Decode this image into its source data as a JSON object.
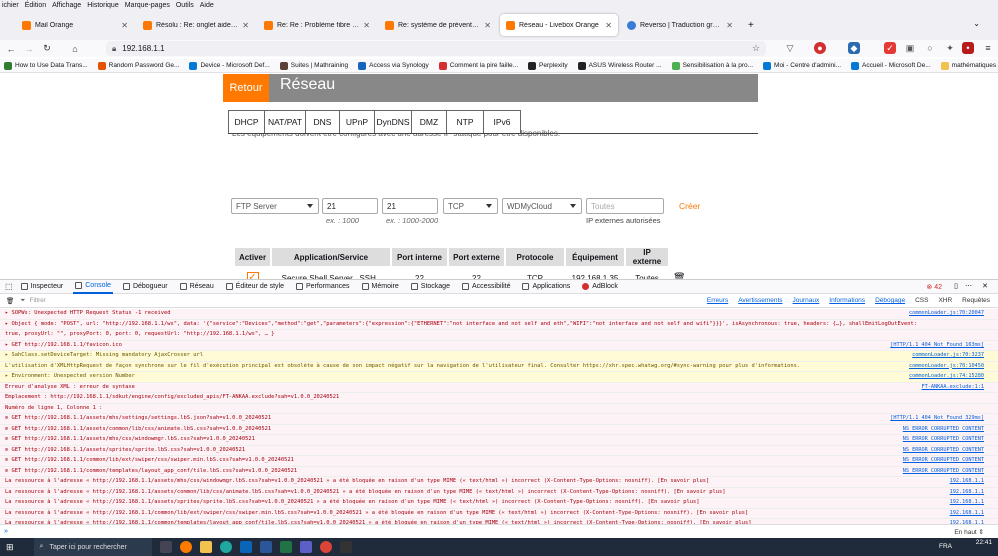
{
  "menubar": [
    "ichier",
    "Édition",
    "Affichage",
    "Historique",
    "Marque-pages",
    "Outils",
    "Aide"
  ],
  "tabs": [
    {
      "title": "Mail Orange",
      "fav": "orange",
      "active": false
    },
    {
      "title": "Résolu : Re: onglet aide et cont",
      "fav": "orange",
      "active": false
    },
    {
      "title": "Re: Re : Problème fibre récurren",
      "fav": "orange",
      "active": false
    },
    {
      "title": "Re: système de prévention d'int",
      "fav": "orange",
      "active": false
    },
    {
      "title": "Réseau - Livebox Orange",
      "fav": "orange",
      "active": true
    },
    {
      "title": "Reverso | Traduction gratuite, di",
      "fav": "blue",
      "active": false
    }
  ],
  "nav": {
    "url": "192.168.1.1",
    "back_icon": "arrow-left-icon",
    "forward_icon": "arrow-right-icon",
    "reload_icon": "reload-icon",
    "lock_icon": "lock-icon",
    "star_icon": "star-icon"
  },
  "bookmarks": [
    "How to Use Data Trans...",
    "Random Password Ge...",
    "Device - Microsoft Def...",
    "Suites | Mathraining",
    "Access via Synology",
    "Comment la pire faille...",
    "Perplexity",
    "ASUS Wireless Router ...",
    "Sensibilisation à la pro...",
    "Moi - Centre d'admini...",
    "Accueil - Microsoft De...",
    "mathématiques"
  ],
  "page": {
    "retour": "Retour",
    "title": "Réseau",
    "subtabs": [
      "DHCP",
      "NAT/PAT",
      "DNS",
      "UPnP",
      "DynDNS",
      "DMZ",
      "NTP",
      "IPv6"
    ],
    "cut_text": "Les équipements doivent être configurés avec une adresse IP statique pour être disponibles.",
    "form": {
      "application": "FTP Server",
      "port_int": "21",
      "port_int_hint": "ex. : 1000",
      "port_ext": "21",
      "port_ext_hint": "ex. : 1000-2000",
      "protocol": "TCP",
      "device": "WDMyCloud",
      "ip_placeholder": "Toutes",
      "ip_hint": "IP externes autorisées",
      "create": "Créer"
    },
    "table": {
      "headers": [
        "Activer",
        "Application/Service",
        "Port interne",
        "Port externe",
        "Protocole",
        "Équipement",
        "IP externe"
      ],
      "rows": [
        {
          "active": "✓",
          "app": "Secure Shell Server _SSH_",
          "port_int": "22",
          "port_ext": "22",
          "proto": "TCP",
          "device": "192.168.1.35",
          "ip": "Toutes"
        }
      ]
    }
  },
  "devtools": {
    "tabs": [
      "Inspecteur",
      "Console",
      "Débogueur",
      "Réseau",
      "Éditeur de style",
      "Performances",
      "Mémoire",
      "Stockage",
      "Accessibilité",
      "Applications",
      "AdBlock"
    ],
    "error_count": "42",
    "filter_placeholder": "Filtrer",
    "filters": [
      "Erreurs",
      "Avertissements",
      "Journaux",
      "Informations",
      "Débogage"
    ],
    "right_filters": [
      "CSS",
      "XHR",
      "Requêtes"
    ],
    "console_input": "»",
    "in_haut": "En haut ⇕"
  },
  "console_rows": [
    {
      "type": "err",
      "text": "▸ SOPWs: Unexpected HTTP Request Status -1 received",
      "src": "commonLoader.js:70:20047"
    },
    {
      "type": "err",
      "text": "  ▸ Object { mode: \"POST\", url: \"http://192.168.1.1/ws\", data: '{\"service\":\"Devices\",\"method\":\"get\",\"parameters\":{\"expression\":{\"ETHERNET\":\"not interface and not self and eth\",\"WIFI\":\"not interface and not self and wifi\"}}}', isAsynchronous: true, headers: {…}, shallEmitLogOutEvent:",
      "src": ""
    },
    {
      "type": "err",
      "text": "    true, proxyUrl: \"\", proxyPort: 0, port: 0, requestUrl: \"http://192.168.1.1/ws\", … }",
      "src": ""
    },
    {
      "type": "err",
      "text": "▸ GET http://192.168.1.1/favicon.ico",
      "src": "[HTTP/1.1 404 Not Found 163ms]"
    },
    {
      "type": "warn",
      "text": "▸ SahClass.setDeviceTarget: Missing mandatory AjaxCrosser url",
      "src": "commonLoader.js:70:3237"
    },
    {
      "type": "warn",
      "text": "L'utilisation d'XMLHttpRequest de façon synchrone sur le fil d'exécution principal est obsolète à cause de son impact négatif sur la navigation de l'utilisateur final. Consulter https://xhr.spec.whatwg.org/#sync-warning pour plus d'informations.",
      "src": "commonLoader.js:70:10450"
    },
    {
      "type": "warn",
      "text": "▸ Environment: Unexpected version Number",
      "src": "commonLoader.js:74:15280"
    },
    {
      "type": "err",
      "text": "Erreur d'analyse XML : erreur de syntaxe",
      "src": "FT-ANKAA.exclude:1:1"
    },
    {
      "type": "err",
      "text": "Emplacement : http://192.168.1.1/sdkut/engine/config/excluded_apis/FT-ANKAA.exclude?sah=v1.0.0_20240521",
      "src": ""
    },
    {
      "type": "err",
      "text": "Numéro de ligne 1, Colonne 1 :",
      "src": ""
    },
    {
      "type": "err",
      "text": "⊘ GET http://192.168.1.1/assets/mhs/settings/settings.lbS.json?sah=v1.0.0_20240521",
      "src": "[HTTP/1.1 404 Not Found 329ms]"
    },
    {
      "type": "err",
      "text": "⊘ GET http://192.168.1.1/assets/common/lib/css/animate.lbS.css?sah=v1.0.0_20240521",
      "src": "NS_ERROR_CORRUPTED_CONTENT"
    },
    {
      "type": "err",
      "text": "⊘ GET http://192.168.1.1/assets/mhs/css/windowmgr.lbS.css?sah=v1.0.0_20240521",
      "src": "NS_ERROR_CORRUPTED_CONTENT"
    },
    {
      "type": "err",
      "text": "⊘ GET http://192.168.1.1/assets/sprites/sprite.lbS.css?sah=v1.0.0_20240521",
      "src": "NS_ERROR_CORRUPTED_CONTENT"
    },
    {
      "type": "err",
      "text": "⊘ GET http://192.168.1.1/common/lib/ext/swiper/css/swiper.min.lbS.css?sah=v1.0.0_20240521",
      "src": "NS_ERROR_CORRUPTED_CONTENT"
    },
    {
      "type": "err",
      "text": "⊘ GET http://192.168.1.1/common/templates/layout_app_conf/tile.lbS.css?sah=v1.0.0_20240521",
      "src": "NS_ERROR_CORRUPTED_CONTENT"
    },
    {
      "type": "err",
      "text": "La ressource à l'adresse « http://192.168.1.1/assets/mhs/css/windowmgr.lbS.css?sah=v1.0.0_20240521 » a été bloquée en raison d'un type MIME (« text/html ») incorrect (X-Content-Type-Options: nosniff). [En savoir plus]",
      "src": "192.168.1.1"
    },
    {
      "type": "err",
      "text": "La ressource à l'adresse « http://192.168.1.1/assets/common/lib/css/animate.lbS.css?sah=v1.0.0_20240521 » a été bloquée en raison d'un type MIME (« text/html ») incorrect (X-Content-Type-Options: nosniff). [En savoir plus]",
      "src": "192.168.1.1"
    },
    {
      "type": "err",
      "text": "La ressource à l'adresse « http://192.168.1.1/assets/sprites/sprite.lbS.css?sah=v1.0.0_20240521 » a été bloquée en raison d'un type MIME (« text/html ») incorrect (X-Content-Type-Options: nosniff). [En savoir plus]",
      "src": "192.168.1.1"
    },
    {
      "type": "err",
      "text": "La ressource à l'adresse « http://192.168.1.1/common/lib/ext/swiper/css/swiper.min.lbS.css?sah=v1.0.0_20240521 » a été bloquée en raison d'un type MIME (« text/html ») incorrect (X-Content-Type-Options: nosniff). [En savoir plus]",
      "src": "192.168.1.1"
    },
    {
      "type": "err",
      "text": "La ressource à l'adresse « http://192.168.1.1/common/templates/layout_app_conf/tile.lbS.css?sah=v1.0.0_20240521 » a été bloquée en raison d'un type MIME (« text/html ») incorrect (X-Content-Type-Options: nosniff). [En savoir plus]",
      "src": "192.168.1.1"
    }
  ],
  "taskbar": {
    "search": "Taper ici pour rechercher",
    "time": "22:41",
    "lang": "FRA"
  },
  "colors": {
    "orange": "#ff7900",
    "header_gray": "#888888",
    "link_blue": "#0060df",
    "error_red": "#a4000f"
  }
}
